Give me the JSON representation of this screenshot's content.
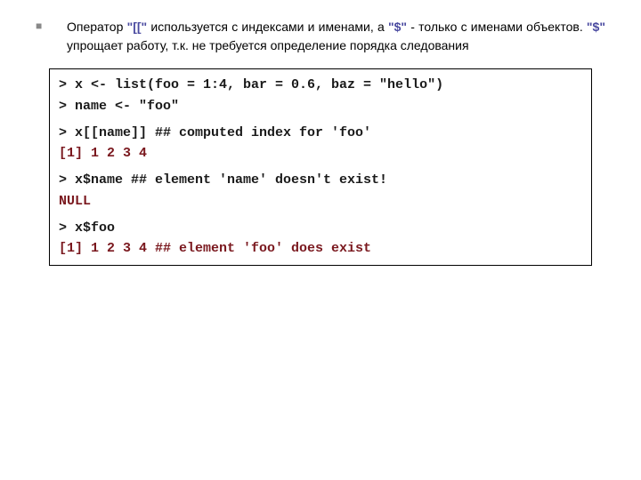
{
  "bullet": {
    "text_a": "Оператор ",
    "op1": "\"[[\"",
    "text_b": " используется с индексами и именами, а ",
    "op2": "\"$\"",
    "text_c": " -  только с именами объектов. ",
    "op3": "\"$\"",
    "text_d": " упрощает работу, т.к. не требуется определение порядка следования"
  },
  "code": {
    "l1": "> x <- list(foo = 1:4, bar = 0.6, baz = \"hello\")",
    "l2": "> name <- \"foo\"",
    "l3": "> x[[name]] ## computed index for 'foo'",
    "l4": "[1] 1 2 3 4",
    "l5": "> x$name ## element 'name' doesn't exist!",
    "l6": "NULL",
    "l7": "> x$foo",
    "l8": "[1] 1 2 3 4 ## element 'foo' does exist"
  }
}
